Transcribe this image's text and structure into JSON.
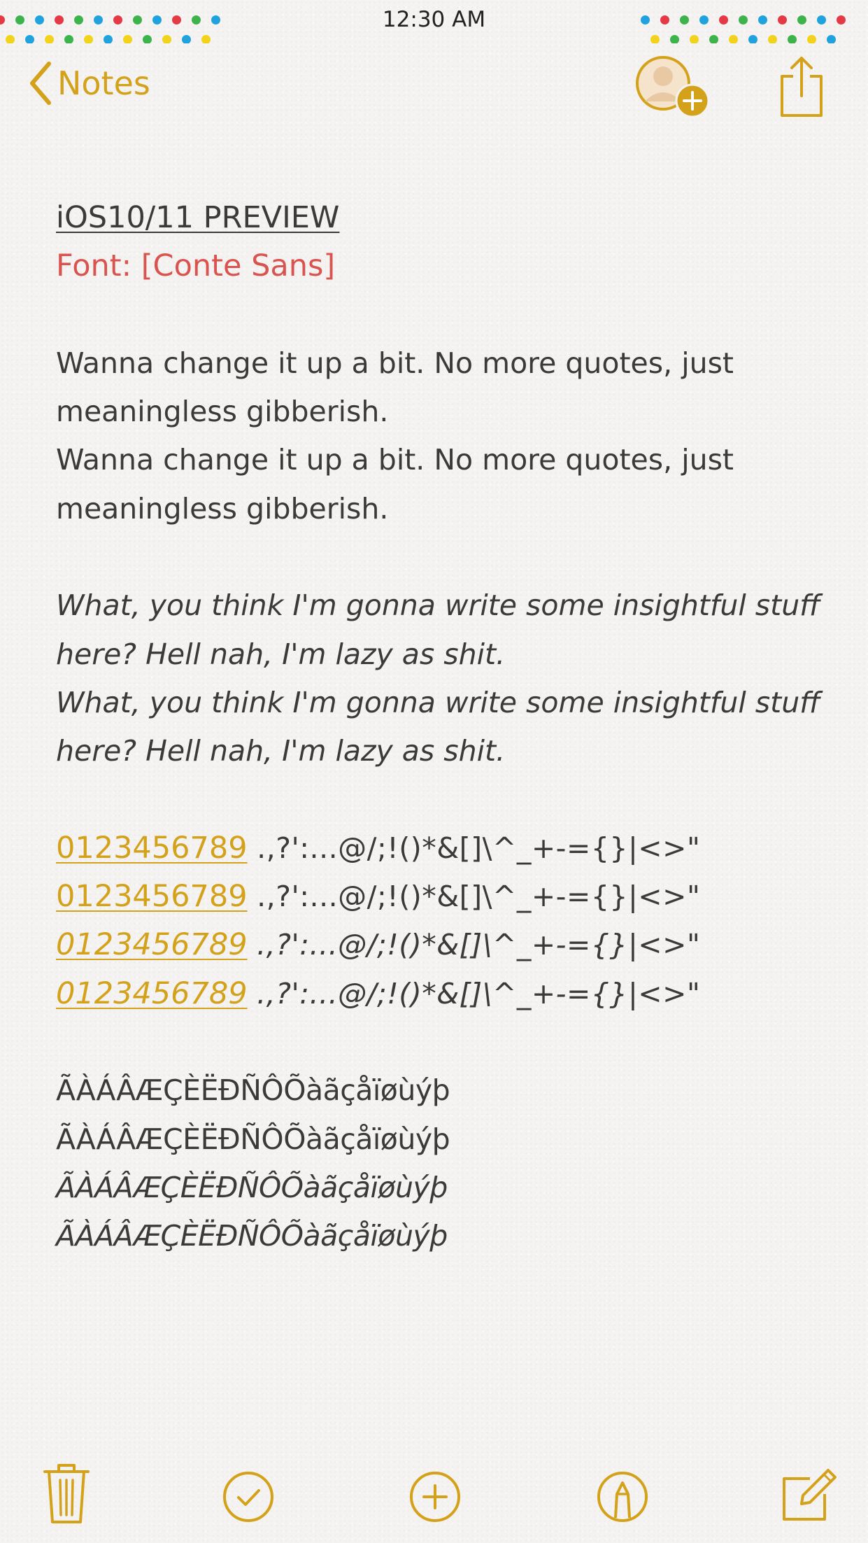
{
  "status_bar": {
    "time": "12:30 AM"
  },
  "nav": {
    "back_label": "Notes",
    "accent_color": "#d4a11b"
  },
  "note": {
    "title": "iOS10/11 PREVIEW",
    "font_line": "Font: [Conte Sans]",
    "paragraph_1": [
      "Wanna change it up a bit. No more quotes, just",
      "meaningless gibberish.",
      "Wanna change it up a bit. No more quotes, just",
      "meaningless gibberish."
    ],
    "paragraph_2": [
      "What, you think I'm gonna write some insightful stuff",
      "here? Hell nah, I'm lazy as shit.",
      "What, you think I'm gonna write some insightful stuff",
      "here? Hell nah, I'm lazy as shit."
    ],
    "number_lines": [
      {
        "numbers": "0123456789",
        "symbols": " .,?':...@/;!()*&[]\\^_+-={}|<>\"",
        "italic": false
      },
      {
        "numbers": "0123456789",
        "symbols": " .,?':...@/;!()*&[]\\^_+-={}|<>\"",
        "italic": false
      },
      {
        "numbers": "0123456789",
        "symbols": " .,?':...@/;!()*&[]\\^_+-={}|<>\"",
        "italic": true
      },
      {
        "numbers": "0123456789",
        "symbols": " .,?':...@/;!()*&[]\\^_+-={}|<>\"",
        "italic": true
      }
    ],
    "accent_lines": [
      "ÃÀÁÂÆÇÈËÐÑÔÕàãçåïøùýþ",
      "ÃÀÁÂÆÇÈËÐÑÔÕàãçåïøùýþ",
      "ÃÀÁÂÆÇÈËÐÑÔÕàãçåïøùýþ",
      "ÃÀÁÂÆÇÈËÐÑÔÕàãçåïøùýþ"
    ],
    "title_color": "#3a3a3a",
    "font_line_color": "#d9534f"
  },
  "toolbar": {
    "icons": [
      "trash-icon",
      "checklist-icon",
      "add-icon",
      "markup-icon",
      "compose-icon"
    ]
  }
}
